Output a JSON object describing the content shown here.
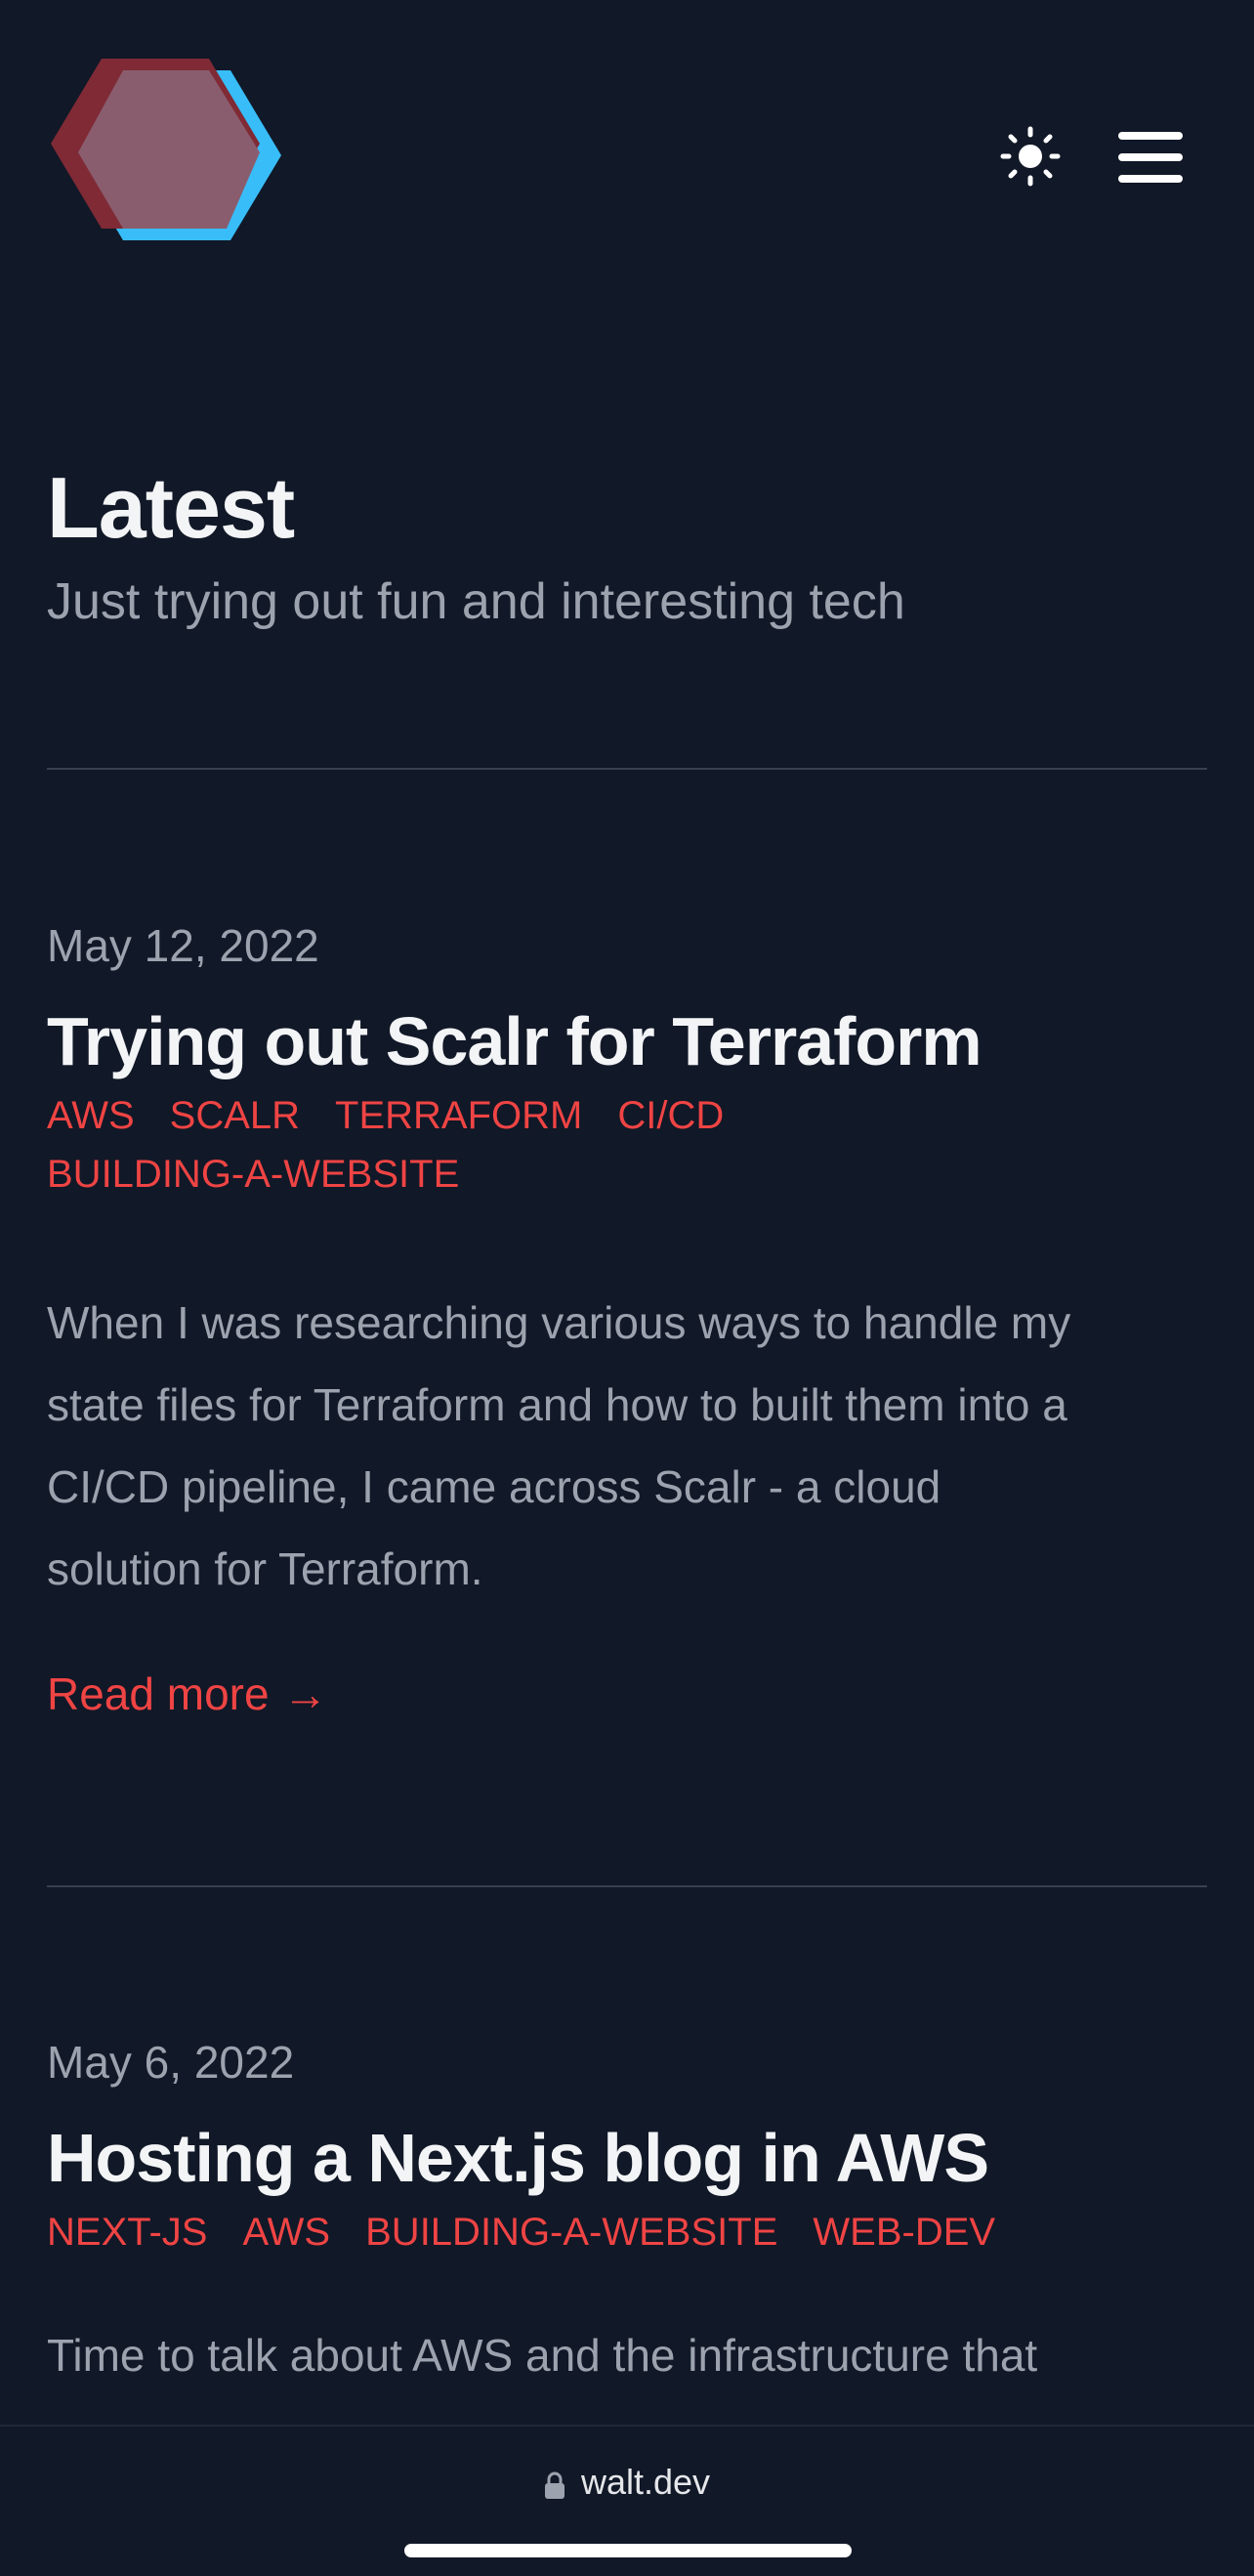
{
  "header": {
    "logo_icon": "hexagon-logo-icon",
    "theme_toggle_icon": "sun-icon",
    "menu_icon": "hamburger-menu-icon"
  },
  "intro": {
    "title": "Latest",
    "subtitle": "Just trying out fun and interesting tech"
  },
  "posts": [
    {
      "date": "May 12, 2022",
      "title": "Trying out Scalr for Terraform",
      "tags": [
        "AWS",
        "SCALR",
        "TERRAFORM",
        "CI/CD",
        "BUILDING-A-WEBSITE"
      ],
      "excerpt_lines": [
        "When I was researching various ways to handle my",
        "state files for Terraform and how to built them into a",
        "CI/CD pipeline, I came across Scalr - a cloud",
        "solution for Terraform."
      ],
      "read_more": "Read more",
      "read_more_arrow": "→"
    },
    {
      "date": "May 6, 2022",
      "title": "Hosting a Next.js blog in AWS",
      "tags": [
        "NEXT-JS",
        "AWS",
        "BUILDING-A-WEBSITE",
        "WEB-DEV"
      ],
      "excerpt_lines": [
        "Time to talk about AWS and the infrastructure that"
      ]
    }
  ],
  "browser": {
    "url": "walt.dev",
    "lock_icon": "lock-icon"
  },
  "colors": {
    "background": "#111827",
    "accent": "#ef4444",
    "muted_text": "#9ca3af",
    "logo_red": "#7f2a35",
    "logo_blue": "#38bdf8"
  }
}
